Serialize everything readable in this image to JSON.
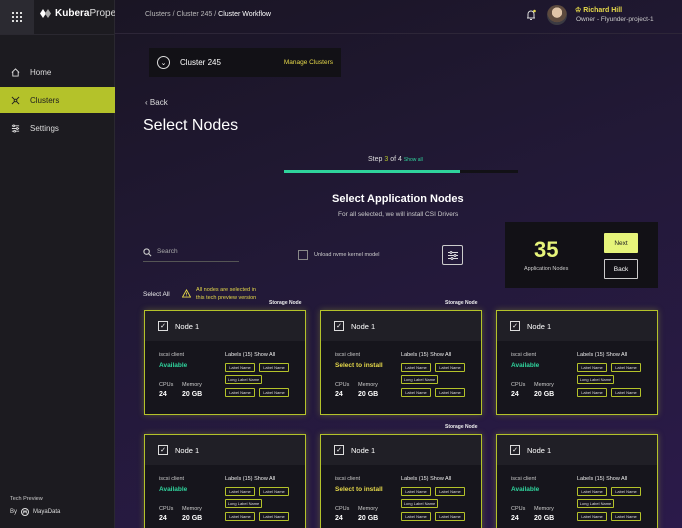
{
  "app": {
    "logo_text_bold": "Kubera",
    "logo_text_light": "Propel"
  },
  "sidebar": {
    "items": [
      {
        "label": "Home",
        "icon": "home-icon"
      },
      {
        "label": "Clusters",
        "icon": "clusters-icon"
      },
      {
        "label": "Settings",
        "icon": "settings-icon"
      }
    ],
    "footer_label": "Tech Preview",
    "by_label": "By",
    "brand": "MayaData"
  },
  "header": {
    "breadcrumb": [
      "Clusters",
      "Cluster 245",
      "Cluster Workflow"
    ],
    "user_name": "Richard Hill",
    "user_role": "Owner - Flyunder-project-1"
  },
  "cluster_select": {
    "name": "Cluster 245",
    "manage_label": "Manage Clusters"
  },
  "page": {
    "back_label": "Back",
    "title": "Select Nodes",
    "step_prefix": "Step",
    "step_current": "3",
    "step_suffix": "of 4",
    "show_all": "Show all",
    "progress": 0.75,
    "section_title": "Select Application Nodes",
    "section_desc": "For all selected, we will install CSI Drivers",
    "search_placeholder": "Search",
    "unload_label": "Unload nvme kernel model",
    "select_all_label": "Select All",
    "warning_line1": "All nodes are selected in",
    "warning_line2": "this tech preview version"
  },
  "summary": {
    "count": "35",
    "label": "Application Nodes",
    "next_label": "Next",
    "back_label": "Back"
  },
  "storage_node_label": "Storage Node",
  "card_common": {
    "iscsi_label": "iscsi client",
    "labels_label": "Labels (15)",
    "show_all_label": "Show All",
    "cpus_label": "CPUs",
    "memory_label": "Memory",
    "chip_short": "Label Name",
    "chip_long": "Long Label Name"
  },
  "cards": [
    {
      "name": "Node 1",
      "status": "Available",
      "cpus": "24",
      "memory": "20 GB"
    },
    {
      "name": "Node 1",
      "status": "Select to install",
      "cpus": "24",
      "memory": "20 GB"
    },
    {
      "name": "Node 1",
      "status": "Available",
      "cpus": "24",
      "memory": "20 GB"
    },
    {
      "name": "Node 1",
      "status": "Available",
      "cpus": "24",
      "memory": "20 GB"
    },
    {
      "name": "Node 1",
      "status": "Select to install",
      "cpus": "24",
      "memory": "20 GB"
    },
    {
      "name": "Node 1",
      "status": "Available",
      "cpus": "24",
      "memory": "20 GB"
    }
  ],
  "colors": {
    "accent": "#b4c22a",
    "success": "#2fd39c",
    "highlight": "#e6f47a",
    "warning": "#e6d94a"
  }
}
